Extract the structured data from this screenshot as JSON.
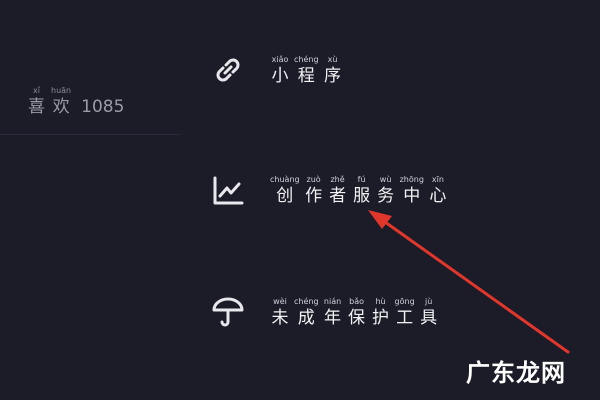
{
  "likes": {
    "pinyin": [
      "xǐ",
      "huān"
    ],
    "hanzi": [
      "喜",
      "欢"
    ],
    "count": "1085"
  },
  "menu": [
    {
      "icon": "link-icon",
      "pinyin": [
        "xiǎo",
        "chéng",
        "xù"
      ],
      "hanzi": [
        "小",
        "程",
        "序"
      ]
    },
    {
      "icon": "chart-trend-icon",
      "pinyin": [
        "chuàng",
        "zuò",
        "zhě",
        "fú",
        "wù",
        "zhōng",
        "xīn"
      ],
      "hanzi": [
        "创",
        "作",
        "者",
        "服",
        "务",
        "中",
        "心"
      ]
    },
    {
      "icon": "umbrella-icon",
      "pinyin": [
        "wèi",
        "chéng",
        "nián",
        "bǎo",
        "hù",
        "gōng",
        "jù"
      ],
      "hanzi": [
        "未",
        "成",
        "年",
        "保",
        "护",
        "工",
        "具"
      ]
    }
  ],
  "annotation": {
    "arrow_color": "#e0362b"
  },
  "watermark": "广东龙网"
}
